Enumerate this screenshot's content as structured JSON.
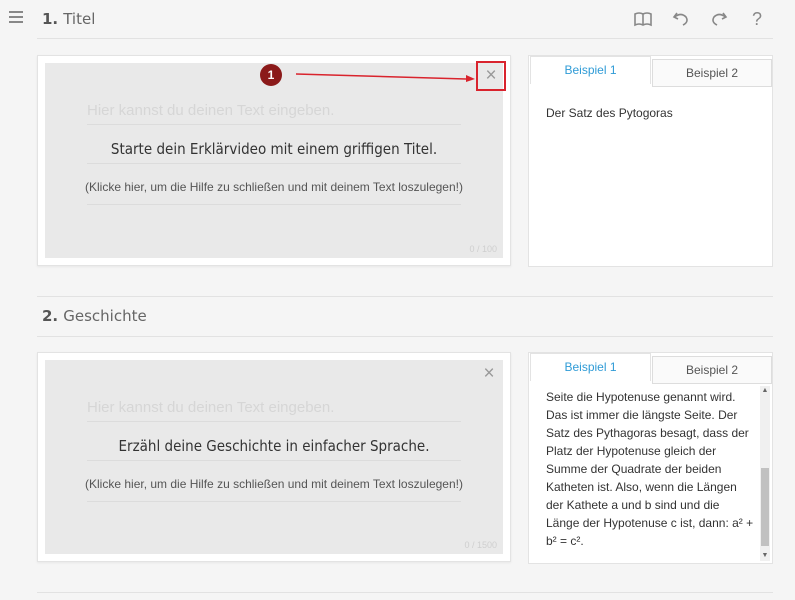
{
  "header": {
    "menu_icon": "hamburger-menu-icon",
    "tools": [
      "book-icon",
      "undo-icon",
      "redo-icon",
      "help-icon"
    ],
    "help_label": "?"
  },
  "sections": [
    {
      "number": "1.",
      "title": "Titel",
      "input": {
        "placeholder": "Hier kannst du deinen Text eingeben.",
        "help_heading": "Starte dein Erklärvideo mit einem griffigen Titel.",
        "help_sub": "(Klicke hier, um die Hilfe zu schließen und mit deinem Text loszulegen!)",
        "counter": "0 / 100",
        "close_label": "×"
      },
      "examples": {
        "tabs": [
          "Beispiel 1",
          "Beispiel 2"
        ],
        "active_tab": 0,
        "text": "Der Satz des Pytogoras"
      }
    },
    {
      "number": "2.",
      "title": "Geschichte",
      "input": {
        "placeholder": "Hier kannst du deinen Text eingeben.",
        "help_heading": "Erzähl deine Geschichte in einfacher Sprache.",
        "help_sub": "(Klicke hier, um die Hilfe zu schließen und mit deinem Text loszulegen!)",
        "counter": "0 / 1500",
        "close_label": "×"
      },
      "examples": {
        "tabs": [
          "Beispiel 1",
          "Beispiel 2"
        ],
        "active_tab": 0,
        "text": "Seite die Hypotenuse genannt wird. Das ist immer die längste Seite. Der Satz des Pythagoras besagt, dass der Platz der Hypotenuse gleich der Summe der Quadrate der beiden Katheten ist. Also, wenn die Längen der Kathete a und b sind und die Länge der Hypotenuse c ist, dann: a² + b² = c²."
      }
    }
  ],
  "annotation": {
    "marker_label": "1",
    "color": "#8b1a1a",
    "highlight_color": "#d9232d"
  },
  "colors": {
    "accent": "#2f9bd6",
    "background": "#f5f5f5"
  }
}
